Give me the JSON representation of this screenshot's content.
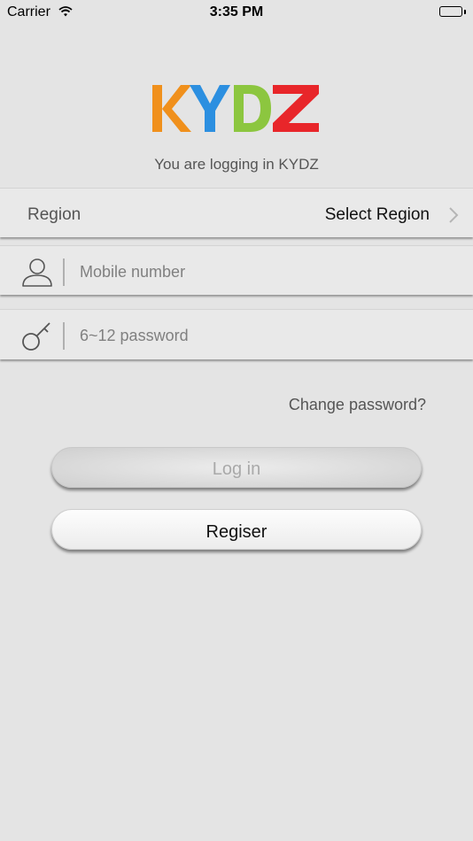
{
  "status_bar": {
    "carrier": "Carrier",
    "time": "3:35 PM"
  },
  "logo": {
    "text": "KYDZ",
    "colors": [
      "#f0901c",
      "#2c8fe0",
      "#8cc63f",
      "#e8262a"
    ]
  },
  "subtitle": "You are logging in KYDZ",
  "region": {
    "label": "Region",
    "value": "Select Region"
  },
  "mobile": {
    "placeholder": "Mobile number",
    "icon": "person-icon"
  },
  "password": {
    "placeholder": "6~12 password",
    "icon": "key-icon"
  },
  "change_password_link": "Change password?",
  "buttons": {
    "login": "Log in",
    "register": "Regiser"
  }
}
